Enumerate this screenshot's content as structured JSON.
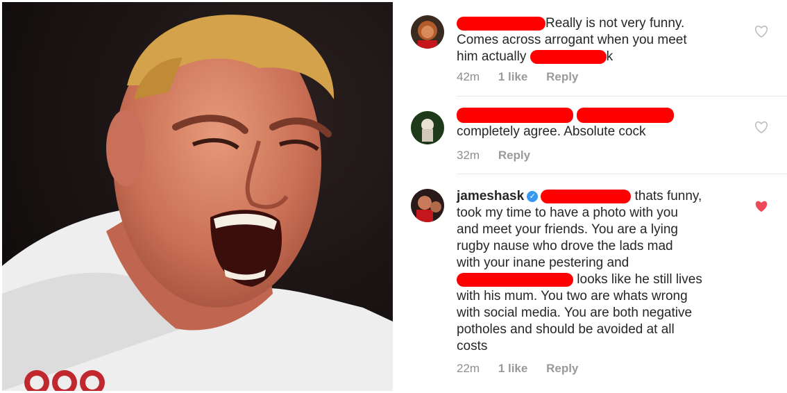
{
  "comments": [
    {
      "text_after_redaction": "Really is not very funny.",
      "line2": "Comes across arrogant when you meet",
      "line3_before": "him actually",
      "line3_after": "k",
      "time": "42m",
      "likes": "1 like",
      "reply": "Reply",
      "liked": false
    },
    {
      "text": "completely agree. Absolute cock",
      "time": "32m",
      "reply": "Reply",
      "liked": false
    },
    {
      "username": "jameshask",
      "verified_icon": "verified-badge-icon",
      "first_after_redaction": "thats funny,",
      "lines": [
        "took my time to have a photo with you",
        "and meet your friends. You are a lying",
        "rugby nause who drove the lads mad",
        "with your inane pestering and"
      ],
      "after_redaction2": "looks like he still lives",
      "lines2": [
        "with his mum. You two are whats wrong",
        "with social media. You are both negative",
        "potholes and should be avoided at all",
        "costs"
      ],
      "time": "22m",
      "likes": "1 like",
      "reply": "Reply",
      "liked": true
    }
  ],
  "colors": {
    "redaction": "#ff0000",
    "heart_liked": "#ed4956",
    "heart_outline": "#bdbdbd",
    "meta_text": "#8e8e8e"
  }
}
